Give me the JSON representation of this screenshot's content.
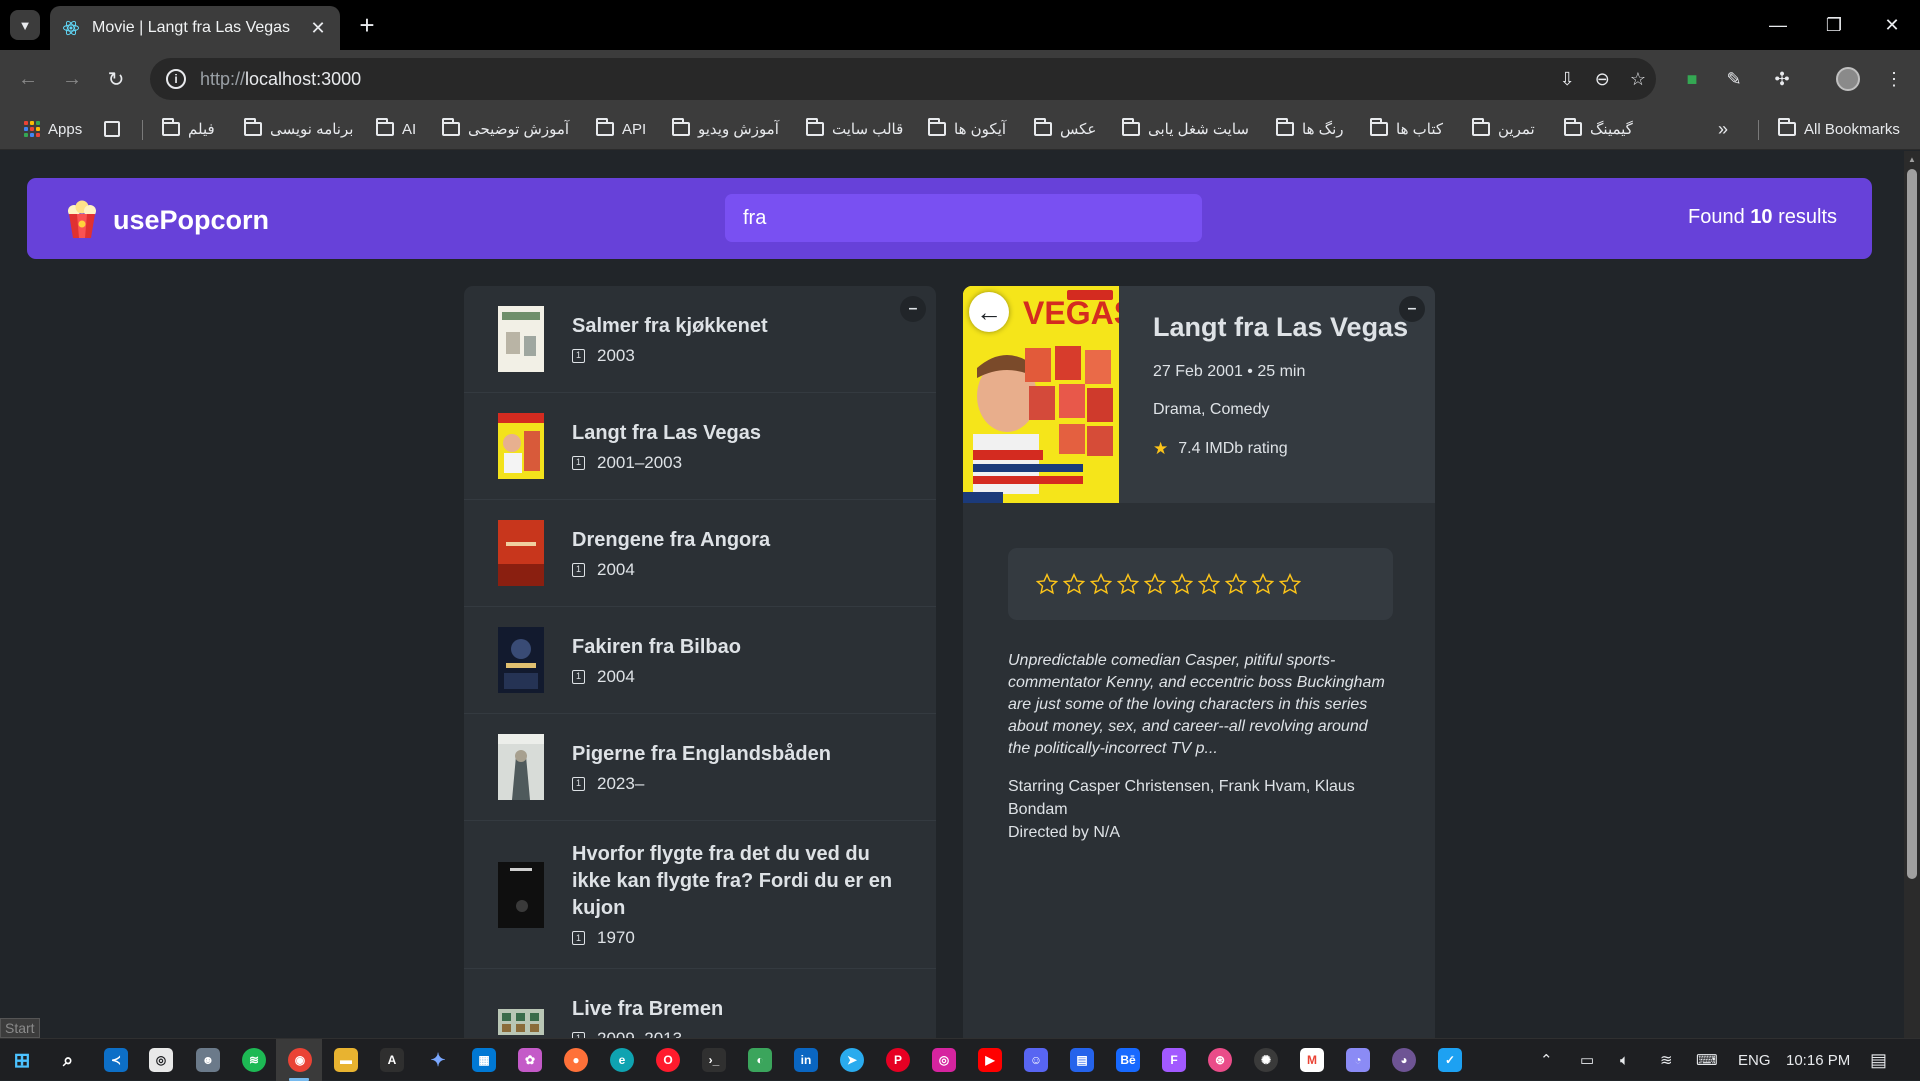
{
  "browser": {
    "tab_title": "Movie | Langt fra Las Vegas",
    "url_protocol": "http://",
    "url_host": "localhost:3000",
    "bookmarks": [
      {
        "label": "Apps",
        "type": "apps"
      },
      {
        "label": "فیلم",
        "type": "folder"
      },
      {
        "label": "برنامه نویسی",
        "type": "folder"
      },
      {
        "label": "AI",
        "type": "folder"
      },
      {
        "label": "آموزش توضیحی",
        "type": "folder"
      },
      {
        "label": "API",
        "type": "folder"
      },
      {
        "label": "آموزش ویدیو",
        "type": "folder"
      },
      {
        "label": "قالب سایت",
        "type": "folder"
      },
      {
        "label": "آیکون ها",
        "type": "folder"
      },
      {
        "label": "عکس",
        "type": "folder"
      },
      {
        "label": "سایت شغل یابی",
        "type": "folder"
      },
      {
        "label": "رنگ ها",
        "type": "folder"
      },
      {
        "label": "کتاب ها",
        "type": "folder"
      },
      {
        "label": "تمرین",
        "type": "folder"
      },
      {
        "label": "گیمینگ",
        "type": "folder"
      }
    ],
    "all_bookmarks": "All Bookmarks",
    "status_text": "Start"
  },
  "app": {
    "logo_text": "usePopcorn",
    "search_value": "fra",
    "results_prefix": "Found",
    "results_count": "10",
    "results_suffix": "results",
    "toggle_symbol": "–"
  },
  "movies": [
    {
      "title": "Salmer fra kjøkkenet",
      "year": "2003"
    },
    {
      "title": "Langt fra Las Vegas",
      "year": "2001–2003"
    },
    {
      "title": "Drengene fra Angora",
      "year": "2004"
    },
    {
      "title": "Fakiren fra Bilbao",
      "year": "2004"
    },
    {
      "title": "Pigerne fra Englandsbåden",
      "year": "2023–"
    },
    {
      "title": "Hvorfor flygte fra det du ved du ikke kan flygte fra? Fordi du er en kujon",
      "year": "1970"
    },
    {
      "title": "Live fra Bremen",
      "year": "2009–2013"
    }
  ],
  "details": {
    "title": "Langt fra Las Vegas",
    "released_runtime": "27 Feb 2001 • 25 min",
    "genre": "Drama, Comedy",
    "rating_text": "7.4 IMDb rating",
    "rating_max": 10,
    "user_rating": 0,
    "plot": "Unpredictable comedian Casper, pitiful sports-commentator Kenny, and eccentric boss Buckingham are just some of the loving characters in this series about money, sex, and career--all revolving around the politically-incorrect TV p...",
    "starring": "Starring Casper Christensen, Frank Hvam, Klaus Bondam",
    "directed": "Directed by N/A",
    "back_symbol": "←"
  },
  "taskbar": {
    "lang": "ENG",
    "time": "10:16 PM"
  },
  "colors": {
    "primary": "#6741d9",
    "primary_light": "#7950f2",
    "background": "#212529",
    "box": "#2b3035",
    "star": "#fcc419"
  }
}
